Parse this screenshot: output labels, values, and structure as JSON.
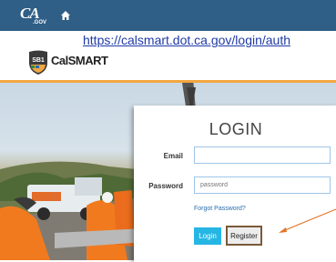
{
  "header": {
    "logo_text": "CA",
    "logo_subtext": ".GOV",
    "home_icon": "home-icon"
  },
  "annotation": {
    "url": "https://calsmart.dot.ca.gov/login/auth",
    "arrow_color": "#e0762a"
  },
  "brand": {
    "badge_text": "SB1",
    "name": "CalSMART"
  },
  "login": {
    "title": "LOGIN",
    "email_label": "Email",
    "email_value": "",
    "password_label": "Password",
    "password_placeholder": "password",
    "forgot_link": "Forgot Password?",
    "login_button": "Login",
    "register_button": "Register"
  },
  "colors": {
    "header_bg": "#2f5e86",
    "accent_stripe": "#f2a640",
    "login_button_bg": "#26b6e4",
    "link": "#2a6db0"
  }
}
